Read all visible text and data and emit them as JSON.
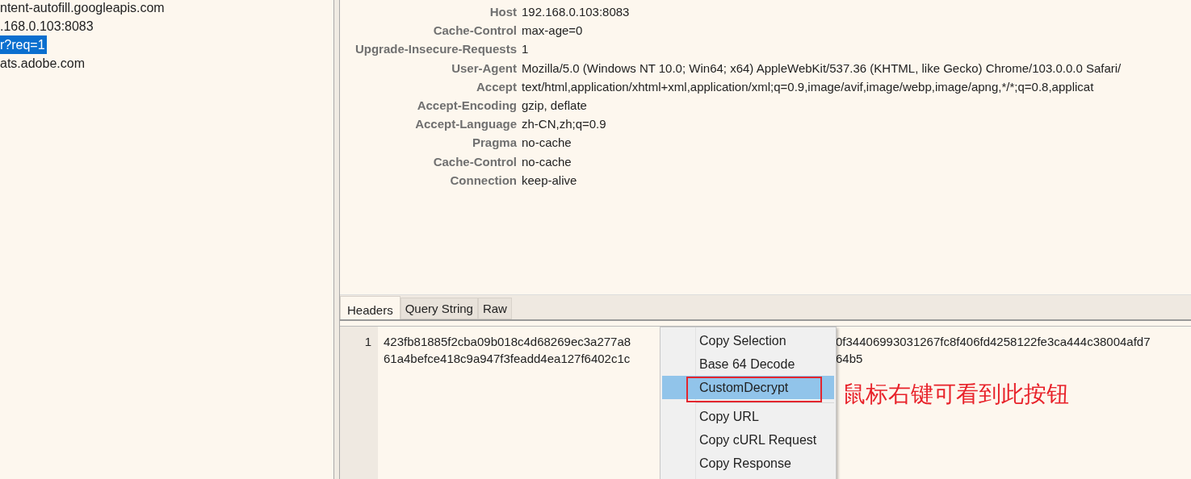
{
  "request_list": {
    "items": [
      {
        "text": "ntent-autofill.googleapis.com",
        "selected": false
      },
      {
        "text": ".168.0.103:8083",
        "selected": false
      },
      {
        "text": "r?req=1",
        "selected": true
      },
      {
        "text": "ats.adobe.com",
        "selected": false
      }
    ]
  },
  "headers": [
    {
      "name": "Host",
      "value": "192.168.0.103:8083"
    },
    {
      "name": "Cache-Control",
      "value": "max-age=0"
    },
    {
      "name": "Upgrade-Insecure-Requests",
      "value": "1"
    },
    {
      "name": "User-Agent",
      "value": "Mozilla/5.0 (Windows NT 10.0; Win64; x64) AppleWebKit/537.36 (KHTML, like Gecko) Chrome/103.0.0.0 Safari/"
    },
    {
      "name": "Accept",
      "value": "text/html,application/xhtml+xml,application/xml;q=0.9,image/avif,image/webp,image/apng,*/*;q=0.8,applicat"
    },
    {
      "name": "Accept-Encoding",
      "value": "gzip, deflate"
    },
    {
      "name": "Accept-Language",
      "value": "zh-CN,zh;q=0.9"
    },
    {
      "name": "Pragma",
      "value": "no-cache"
    },
    {
      "name": "Cache-Control",
      "value": "no-cache"
    },
    {
      "name": "Connection",
      "value": "keep-alive"
    }
  ],
  "tabs": [
    {
      "label": "Headers",
      "selected": true
    },
    {
      "label": "Query String",
      "selected": false
    },
    {
      "label": "Raw",
      "selected": false
    }
  ],
  "body": {
    "line_number": "1",
    "rows": [
      {
        "left": "423fb81885f2cba09b018c4d68269ec3a277a8",
        "right": "0f34406993031267fc8f406fd4258122fe3ca444c38004afd7"
      },
      {
        "left": "61a4befce418c9a947f3feadd4ea127f6402c1c",
        "right": "64b5"
      }
    ]
  },
  "context_menu": {
    "items": [
      {
        "kind": "item",
        "label": "Copy Selection",
        "selected": false
      },
      {
        "kind": "item",
        "label": "Base 64 Decode",
        "selected": false
      },
      {
        "kind": "item",
        "label": "CustomDecrypt",
        "selected": true
      },
      {
        "kind": "separator"
      },
      {
        "kind": "item",
        "label": "Copy URL",
        "selected": false
      },
      {
        "kind": "item",
        "label": "Copy cURL Request",
        "selected": false
      },
      {
        "kind": "item",
        "label": "Copy Response",
        "selected": false
      }
    ]
  },
  "annotation": {
    "text": "鼠标右键可看到此按钮"
  }
}
